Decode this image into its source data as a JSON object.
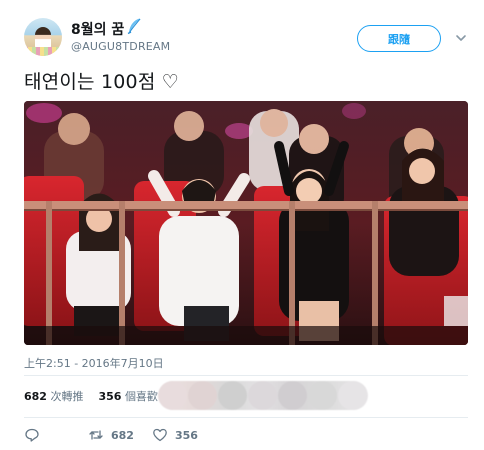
{
  "user": {
    "name": "8월의 꿈",
    "handle": "@AUGU8TDREAM"
  },
  "follow_button": {
    "label": "跟隨"
  },
  "tweet": {
    "text": "태연이는 100점 ♡",
    "timestamp": "上午2:51 - 2016年7月10日"
  },
  "stats": {
    "retweets_count": "682",
    "retweets_label": "次轉推",
    "likes_count": "356",
    "likes_label": "個喜歡"
  },
  "actions": {
    "retweet_count": "682",
    "like_count": "356"
  },
  "colors": {
    "accent": "#1da1f2",
    "text": "#14171a",
    "secondary": "#657786",
    "divider": "#e6ecf0"
  },
  "icons": [
    "verified-feather-icon",
    "chevron-down-icon",
    "reply-icon",
    "retweet-icon",
    "heart-icon"
  ]
}
